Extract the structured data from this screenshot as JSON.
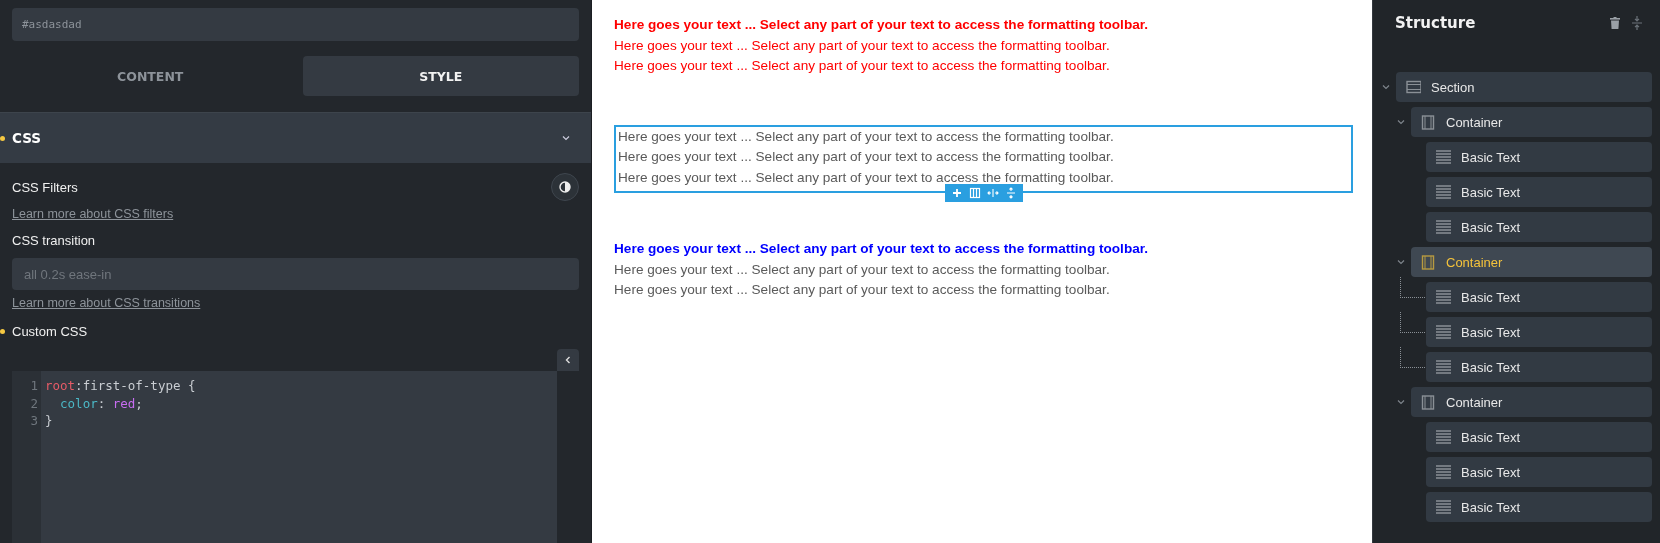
{
  "left_panel": {
    "id_field": {
      "value": "#asdasdad"
    },
    "tabs": [
      {
        "label": "CONTENT",
        "selected": false
      },
      {
        "label": "STYLE",
        "selected": true
      }
    ],
    "css_section": {
      "title": "CSS",
      "expanded": true,
      "modified": true,
      "filters_label": "CSS Filters",
      "filters_link": "Learn more about CSS filters",
      "transition_label": "CSS transition",
      "transition_field": {
        "placeholder": "all 0.2s ease-in"
      },
      "transition_link": "Learn more about CSS transitions",
      "custom_css": {
        "label": "Custom CSS",
        "modified": true,
        "code": [
          {
            "number": "1",
            "tokens": [
              {
                "kind": "selector",
                "text": "root"
              },
              {
                "kind": "plain",
                "text": ":first-of-type {"
              }
            ]
          },
          {
            "number": "2",
            "tokens": [
              {
                "kind": "property",
                "text": "  color"
              },
              {
                "kind": "plain",
                "text": ": "
              },
              {
                "kind": "value",
                "text": "red"
              },
              {
                "kind": "plain",
                "text": ";"
              }
            ]
          },
          {
            "number": "3",
            "tokens": [
              {
                "kind": "plain",
                "text": "}"
              }
            ]
          }
        ]
      }
    }
  },
  "canvas": {
    "blocks": [
      {
        "selected": false,
        "lines": [
          {
            "text": "Here goes your text ... Select any part of your text to access the formatting toolbar.",
            "color": "#ff0000",
            "bold": true
          },
          {
            "text": "Here goes your text ... Select any part of your text to access the formatting toolbar.",
            "color": "#ff0000",
            "bold": false
          },
          {
            "text": "Here goes your text ... Select any part of your text to access the formatting toolbar.",
            "color": "#ff0000",
            "bold": false
          }
        ]
      },
      {
        "selected": true,
        "lines": [
          {
            "text": "Here goes your text ... Select any part of your text to access the formatting toolbar.",
            "color": "#5a5a5a",
            "bold": false
          },
          {
            "text": "Here goes your text ... Select any part of your text to access the formatting toolbar.",
            "color": "#5a5a5a",
            "bold": false
          },
          {
            "text": "Here goes your text ... Select any part of your text to access the formatting toolbar.",
            "color": "#5a5a5a",
            "bold": false
          }
        ]
      },
      {
        "selected": false,
        "lines": [
          {
            "text": "Here goes your text ... Select any part of your text to access the formatting toolbar.",
            "color": "#0000ff",
            "bold": true
          },
          {
            "text": "Here goes your text ... Select any part of your text to access the formatting toolbar.",
            "color": "#5a5a5a",
            "bold": false
          },
          {
            "text": "Here goes your text ... Select any part of your text to access the formatting toolbar.",
            "color": "#5a5a5a",
            "bold": false
          }
        ]
      }
    ]
  },
  "structure": {
    "title": "Structure",
    "tree": [
      {
        "label": "Section",
        "kind": "section",
        "selected": false,
        "expanded": true,
        "children": [
          {
            "label": "Container",
            "kind": "container",
            "selected": false,
            "expanded": true,
            "children": [
              {
                "label": "Basic Text",
                "kind": "text",
                "selected": false
              },
              {
                "label": "Basic Text",
                "kind": "text",
                "selected": false
              },
              {
                "label": "Basic Text",
                "kind": "text",
                "selected": false
              }
            ]
          },
          {
            "label": "Container",
            "kind": "container",
            "selected": true,
            "expanded": true,
            "children": [
              {
                "label": "Basic Text",
                "kind": "text",
                "selected": false
              },
              {
                "label": "Basic Text",
                "kind": "text",
                "selected": false
              },
              {
                "label": "Basic Text",
                "kind": "text",
                "selected": false
              }
            ]
          },
          {
            "label": "Container",
            "kind": "container",
            "selected": false,
            "expanded": true,
            "children": [
              {
                "label": "Basic Text",
                "kind": "text",
                "selected": false
              },
              {
                "label": "Basic Text",
                "kind": "text",
                "selected": false
              },
              {
                "label": "Basic Text",
                "kind": "text",
                "selected": false
              }
            ]
          }
        ]
      }
    ]
  }
}
